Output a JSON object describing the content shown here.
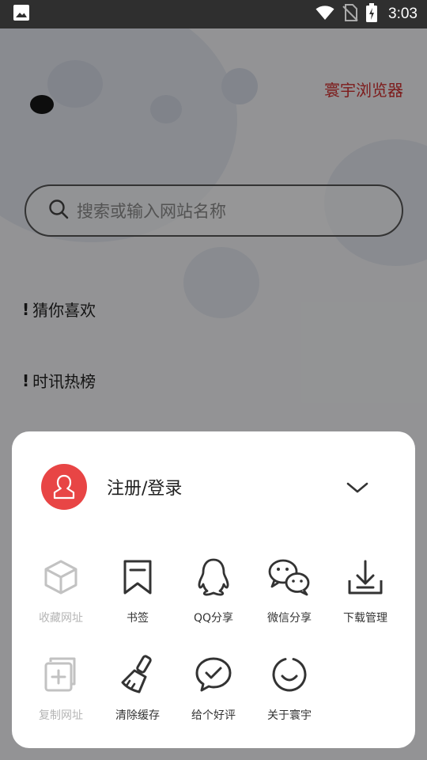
{
  "status_bar": {
    "time": "3:03"
  },
  "home": {
    "brand": "寰宇浏览器",
    "search": {
      "placeholder": "搜索或输入网站名称"
    },
    "sections": [
      {
        "mark": "!",
        "title": "猜你喜欢"
      },
      {
        "mark": "!",
        "title": "时讯热榜"
      }
    ]
  },
  "menu": {
    "login_label": "注册/登录",
    "items": [
      {
        "label": "收藏网址",
        "icon": "cube-icon",
        "enabled": false
      },
      {
        "label": "书签",
        "icon": "bookmark-icon",
        "enabled": true
      },
      {
        "label": "QQ分享",
        "icon": "qq-icon",
        "enabled": true
      },
      {
        "label": "微信分享",
        "icon": "wechat-icon",
        "enabled": true
      },
      {
        "label": "下载管理",
        "icon": "download-icon",
        "enabled": true
      },
      {
        "label": "复制网址",
        "icon": "copy-icon",
        "enabled": false
      },
      {
        "label": "清除缓存",
        "icon": "broom-icon",
        "enabled": true
      },
      {
        "label": "给个好评",
        "icon": "rating-icon",
        "enabled": true
      },
      {
        "label": "关于寰宇",
        "icon": "smile-icon",
        "enabled": true
      }
    ]
  },
  "colors": {
    "brand_red": "#d12f2f",
    "avatar_red": "#e84545",
    "icon_dark": "#333333",
    "icon_disabled": "#c2c2c2"
  }
}
